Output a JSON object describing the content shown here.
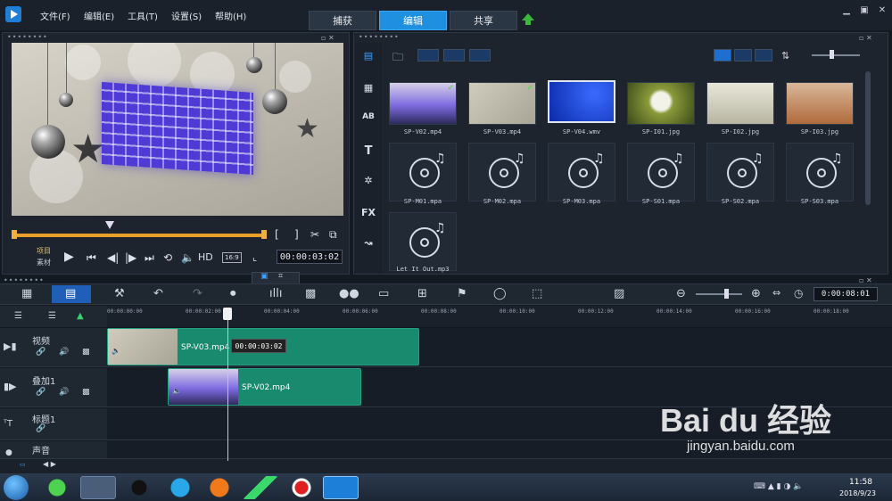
{
  "menu": {
    "file": "文件(F)",
    "edit": "编辑(E)",
    "tools": "工具(T)",
    "settings": "设置(S)",
    "help": "帮助(H)"
  },
  "main_tabs": {
    "capture": "捕获",
    "edit": "编辑",
    "share": "共享"
  },
  "window": {
    "min": "▁",
    "restore": "▣",
    "close": "✕"
  },
  "player": {
    "project": "项目",
    "clip": "素材",
    "hd": "HD",
    "aspect": "16:9",
    "timecode": "00:00:03:02",
    "mark_in": "[",
    "mark_out": "]"
  },
  "library": {
    "media": [
      {
        "name": "SP-V02.mp4"
      },
      {
        "name": "SP-V03.mp4"
      },
      {
        "name": "SP-V04.wmv"
      },
      {
        "name": "SP-I01.jpg"
      },
      {
        "name": "SP-I02.jpg"
      },
      {
        "name": "SP-I03.jpg"
      }
    ],
    "audio": [
      {
        "name": "SP-M01.mpa"
      },
      {
        "name": "SP-M02.mpa"
      },
      {
        "name": "SP-M03.mpa"
      },
      {
        "name": "SP-S01.mpa"
      },
      {
        "name": "SP-S02.mpa"
      },
      {
        "name": "SP-S03.mpa"
      },
      {
        "name": "Let It Out.mp3"
      }
    ],
    "rail_fx": "FX",
    "rail_ab": "AB",
    "rail_t": "T"
  },
  "timeline": {
    "timecode": "0:00:08:01",
    "ruler": [
      "00:00:00:00",
      "00:00:02:00",
      "00:00:04:00",
      "00:00:06:00",
      "00:00:08:00",
      "00:00:10:00",
      "00:00:12:00",
      "00:00:14:00",
      "00:00:16:00",
      "00:00:18:00"
    ],
    "tracks": [
      {
        "name": "视频"
      },
      {
        "name": "叠加1"
      },
      {
        "name": "标题1"
      },
      {
        "name": "声音"
      }
    ],
    "clip_video": "SP-V03.mp4",
    "clip_overlay": "SP-V02.mp4",
    "tooltip": "00:00:03:02"
  },
  "taskbar": {
    "time": "11:58",
    "date": "2018/9/23"
  },
  "watermark": {
    "brand": "Bai du 经验",
    "url": "jingyan.baidu.com"
  }
}
